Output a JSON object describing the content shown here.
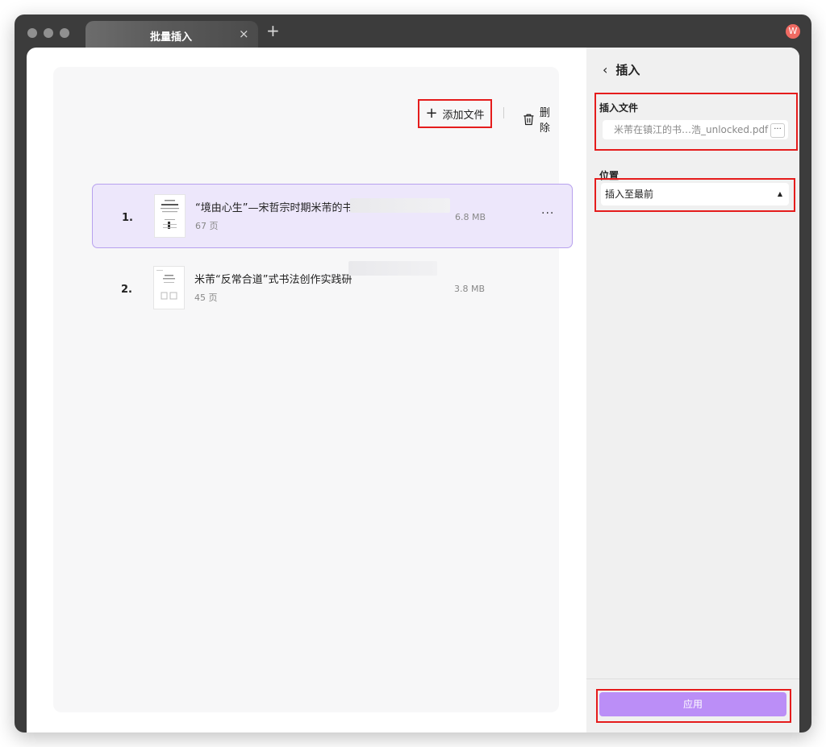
{
  "window": {
    "tab_title": "批量插入",
    "tab_close": "×",
    "new_tab": "+",
    "avatar_initial": "W"
  },
  "toolbar": {
    "add_file_label": "添加文件",
    "delete_label": "删除"
  },
  "files": [
    {
      "index": "1.",
      "title": "“境由心生”—宋哲宗时期米芾的书法研",
      "pages": "67 页",
      "size": "6.8 MB",
      "more": "···",
      "selected": true
    },
    {
      "index": "2.",
      "title": "米芾“反常合道”式书法创作实践研",
      "pages": "45 页",
      "size": "3.8 MB",
      "selected": false
    }
  ],
  "panel": {
    "back_label": "插入",
    "insert_file_label": "插入文件",
    "insert_file_value": "米芾在镇江的书…浩_unlocked.pdf",
    "insert_file_more": "···",
    "position_label": "位置",
    "position_value": "插入至最前",
    "apply_label": "应用"
  },
  "colors": {
    "accent": "#bb8ef7",
    "selected_row_bg": "#ede7fb",
    "selected_row_border": "#b7a1ee",
    "highlight_box": "#e51c1c",
    "avatar": "#ef6a62"
  }
}
